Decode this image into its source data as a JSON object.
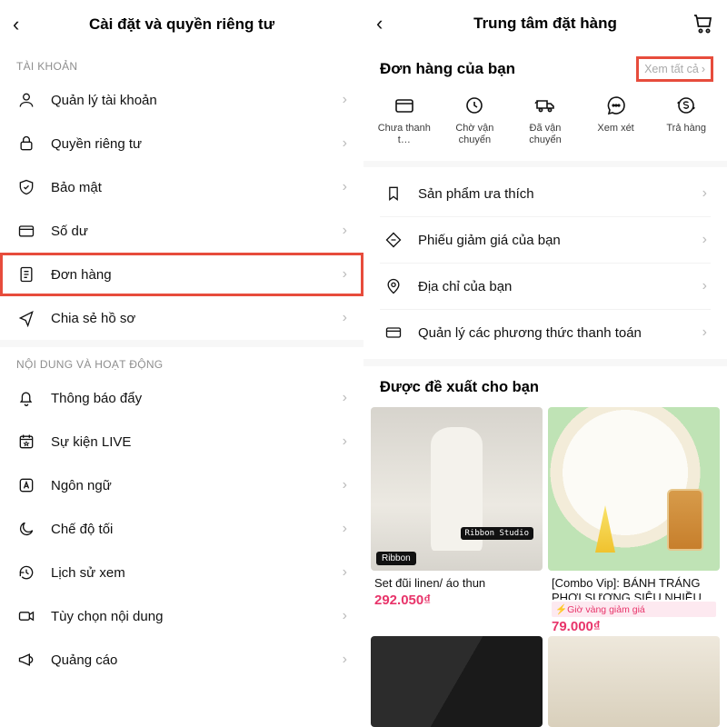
{
  "left": {
    "title": "Cài đặt và quyền riêng tư",
    "section_account": "TÀI KHOẢN",
    "section_content": "NỘI DUNG VÀ HOẠT ĐỘNG",
    "items_account": [
      {
        "label": "Quản lý tài khoản"
      },
      {
        "label": "Quyền riêng tư"
      },
      {
        "label": "Bảo mật"
      },
      {
        "label": "Số dư"
      },
      {
        "label": "Đơn hàng"
      },
      {
        "label": "Chia sẻ hồ sơ"
      }
    ],
    "items_content": [
      {
        "label": "Thông báo đẩy"
      },
      {
        "label": "Sự kiện LIVE"
      },
      {
        "label": "Ngôn ngữ"
      },
      {
        "label": "Chế độ tối"
      },
      {
        "label": "Lịch sử xem"
      },
      {
        "label": "Tùy chọn nội dung"
      },
      {
        "label": "Quảng cáo"
      }
    ]
  },
  "right": {
    "title": "Trung tâm đặt hàng",
    "orders_heading": "Đơn hàng của bạn",
    "view_all": "Xem tất cả",
    "statuses": [
      {
        "label": "Chưa thanh t…"
      },
      {
        "label": "Chờ vận chuyển"
      },
      {
        "label": "Đã vận chuyển"
      },
      {
        "label": "Xem xét"
      },
      {
        "label": "Trả hàng"
      }
    ],
    "menu": [
      {
        "label": "Sản phẩm ưa thích"
      },
      {
        "label": "Phiếu giảm giá của bạn"
      },
      {
        "label": "Địa chỉ của bạn"
      },
      {
        "label": "Quản lý các phương thức thanh toán"
      }
    ],
    "rec_heading": "Được đề xuất cho bạn",
    "products": [
      {
        "title": "Set đũi linen/ áo thun",
        "price": "292.050₫",
        "tag": "Ribbon",
        "studio": "Ribbon Studio"
      },
      {
        "title": "[Combo Vip]: BÁNH TRÁNG PHƠI SƯƠNG SIÊU NHIỀU B…",
        "price": "79.000₫",
        "badge": "⚡Giờ vàng giảm giá"
      }
    ]
  }
}
